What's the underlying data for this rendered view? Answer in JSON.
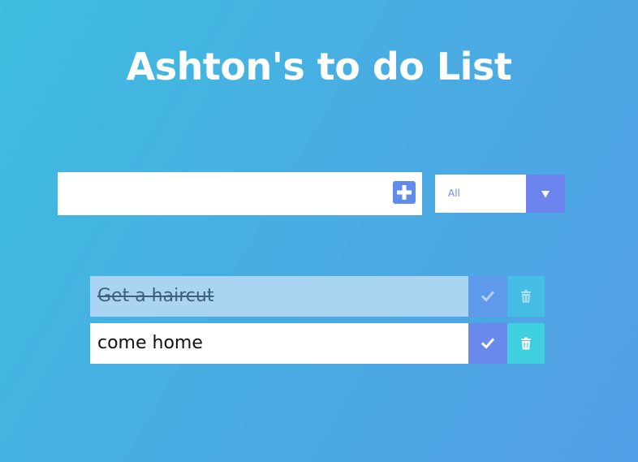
{
  "page": {
    "title": "Ashton's to do List"
  },
  "form": {
    "input_value": "",
    "add_icon": "plus-square-icon",
    "filter_selected": "All",
    "filter_arrow_icon": "caret-down-icon"
  },
  "todos": [
    {
      "text": "Get a haircut",
      "completed": true
    },
    {
      "text": "come home",
      "completed": false
    }
  ],
  "icons": {
    "complete": "check-icon",
    "delete": "trash-icon"
  },
  "colors": {
    "background_start": "#3dbde0",
    "background_end": "#529ee6",
    "accent": "#6a89ec",
    "delete": "#3ed0df"
  }
}
